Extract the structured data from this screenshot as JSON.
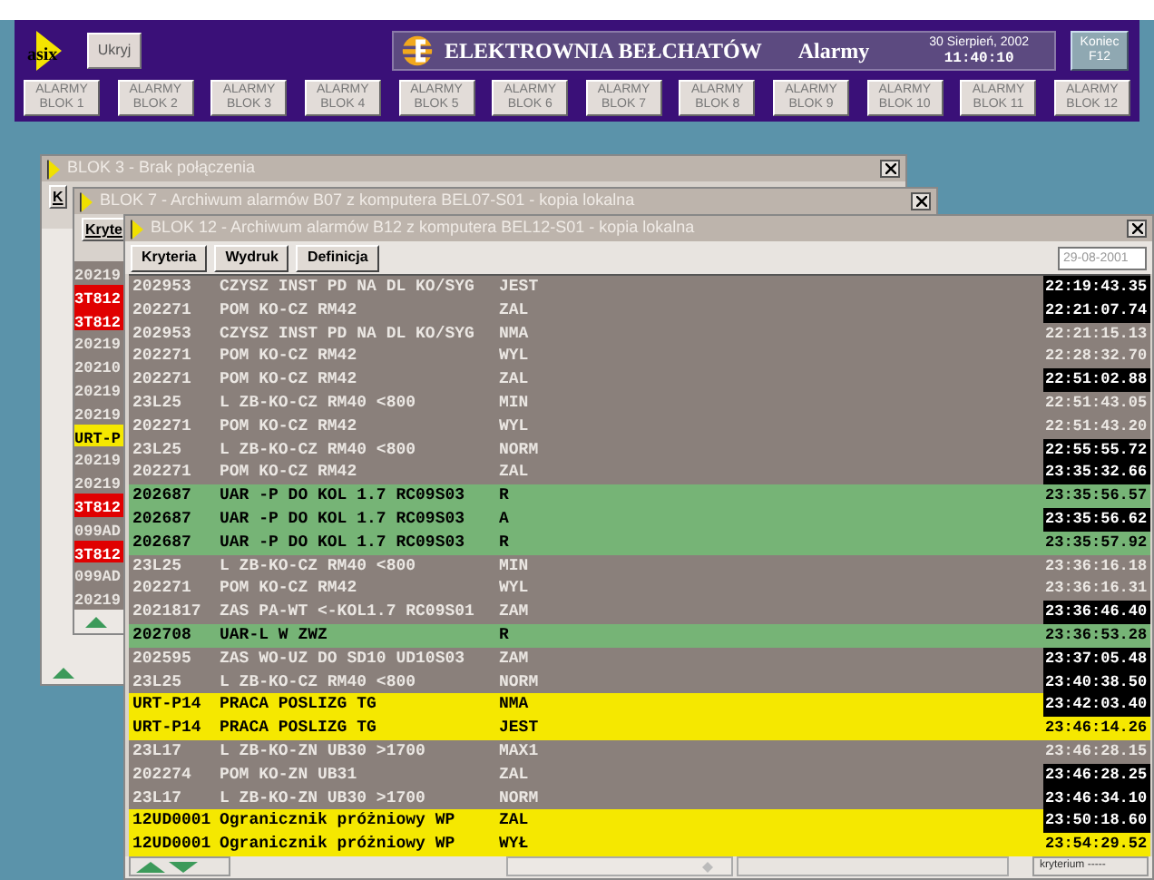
{
  "header": {
    "logo": "asix",
    "hide_button": "Ukryj",
    "plant_name": "ELEKTROWNIA BEŁCHATÓW",
    "screen_name": "Alarmy",
    "date": "30 Sierpień, 2002",
    "time": "11:40:10",
    "exit_button": [
      "Koniec",
      "F12"
    ],
    "block_buttons": [
      {
        "lines": [
          "ALARMY",
          "BLOK 1"
        ]
      },
      {
        "lines": [
          "ALARMY",
          "BLOK 2"
        ]
      },
      {
        "lines": [
          "ALARMY",
          "BLOK 3"
        ]
      },
      {
        "lines": [
          "ALARMY",
          "BLOK 4"
        ]
      },
      {
        "lines": [
          "ALARMY",
          "BLOK 5"
        ]
      },
      {
        "lines": [
          "ALARMY",
          "BLOK 6"
        ]
      },
      {
        "lines": [
          "ALARMY",
          "BLOK 7"
        ]
      },
      {
        "lines": [
          "ALARMY",
          "BLOK 8"
        ]
      },
      {
        "lines": [
          "ALARMY",
          "BLOK 9"
        ]
      },
      {
        "lines": [
          "ALARMY",
          "BLOK 10"
        ]
      },
      {
        "lines": [
          "ALARMY",
          "BLOK 11"
        ]
      },
      {
        "lines": [
          "ALARMY",
          "BLOK 12"
        ]
      }
    ]
  },
  "back_windows": [
    {
      "title": "BLOK 3 - Brak połączenia",
      "toolbar_buttons": [
        "K"
      ]
    },
    {
      "title": "BLOK 7 - Archiwum alarmów B07 z komputera BEL07-S01 - kopia lokalna",
      "toolbar_buttons": [
        "Kryte"
      ],
      "rows": [
        {
          "code": "20219",
          "kind": "normal"
        },
        {
          "code": "3T812",
          "kind": "red"
        },
        {
          "code": "3T812",
          "kind": "red"
        },
        {
          "code": "20219",
          "kind": "normal"
        },
        {
          "code": "20210",
          "kind": "normal"
        },
        {
          "code": "20219",
          "kind": "normal"
        },
        {
          "code": "20219",
          "kind": "normal"
        },
        {
          "code": "URT-P",
          "kind": "yellow"
        },
        {
          "code": "20219",
          "kind": "normal"
        },
        {
          "code": "20219",
          "kind": "normal"
        },
        {
          "code": "3T812",
          "kind": "red"
        },
        {
          "code": "099AD",
          "kind": "normal"
        },
        {
          "code": "3T812",
          "kind": "red"
        },
        {
          "code": "099AD",
          "kind": "normal"
        },
        {
          "code": "20219",
          "kind": "normal"
        }
      ]
    }
  ],
  "window": {
    "title": "BLOK 12 - Archiwum alarmów B12 z komputera BEL12-S01 - kopia lokalna",
    "toolbar_buttons": [
      "Kryteria",
      "Wydruk",
      "Definicja"
    ],
    "date_field": "29-08-2001",
    "status": "kryterium -----",
    "rows": [
      {
        "code": "202953",
        "text": "CZYSZ INST PD NA DL KO/SYG",
        "state": "JEST",
        "time": "22:19:43.35",
        "kind": "normal",
        "highlighted": true
      },
      {
        "code": "202271",
        "text": "POM KO-CZ RM42",
        "state": "ZAL",
        "time": "22:21:07.74",
        "kind": "normal",
        "highlighted": true
      },
      {
        "code": "202953",
        "text": "CZYSZ INST PD NA DL KO/SYG",
        "state": "NMA",
        "time": "22:21:15.13",
        "kind": "normal",
        "highlighted": false
      },
      {
        "code": "202271",
        "text": "POM KO-CZ RM42",
        "state": "WYL",
        "time": "22:28:32.70",
        "kind": "normal",
        "highlighted": false
      },
      {
        "code": "202271",
        "text": "POM KO-CZ RM42",
        "state": "ZAL",
        "time": "22:51:02.88",
        "kind": "normal",
        "highlighted": true
      },
      {
        "code": "23L25",
        "text": "L ZB-KO-CZ RM40 <800",
        "state": "MIN",
        "time": "22:51:43.05",
        "kind": "normal",
        "highlighted": false
      },
      {
        "code": "202271",
        "text": "POM KO-CZ RM42",
        "state": "WYL",
        "time": "22:51:43.20",
        "kind": "normal",
        "highlighted": false
      },
      {
        "code": "23L25",
        "text": "L ZB-KO-CZ RM40 <800",
        "state": "NORM",
        "time": "22:55:55.72",
        "kind": "normal",
        "highlighted": true
      },
      {
        "code": "202271",
        "text": "POM KO-CZ RM42",
        "state": "ZAL",
        "time": "23:35:32.66",
        "kind": "normal",
        "highlighted": true
      },
      {
        "code": "202687",
        "text": "UAR -P DO KOL 1.7 RC09S03",
        "state": "R",
        "time": "23:35:56.57",
        "kind": "green",
        "highlighted": false
      },
      {
        "code": "202687",
        "text": "UAR -P DO KOL 1.7 RC09S03",
        "state": "A",
        "time": "23:35:56.62",
        "kind": "green",
        "highlighted": true
      },
      {
        "code": "202687",
        "text": "UAR -P DO KOL 1.7 RC09S03",
        "state": "R",
        "time": "23:35:57.92",
        "kind": "green",
        "highlighted": false
      },
      {
        "code": "23L25",
        "text": "L ZB-KO-CZ RM40 <800",
        "state": "MIN",
        "time": "23:36:16.18",
        "kind": "normal",
        "highlighted": false
      },
      {
        "code": "202271",
        "text": "POM KO-CZ RM42",
        "state": "WYL",
        "time": "23:36:16.31",
        "kind": "normal",
        "highlighted": false
      },
      {
        "code": "2021817",
        "text": "ZAS PA-WT <-KOL1.7 RC09S01",
        "state": "ZAM",
        "time": "23:36:46.40",
        "kind": "normal",
        "highlighted": true
      },
      {
        "code": "202708",
        "text": "UAR-L W ZWZ",
        "state": "R",
        "time": "23:36:53.28",
        "kind": "green",
        "highlighted": false
      },
      {
        "code": "202595",
        "text": "ZAS WO-UZ DO SD10 UD10S03",
        "state": "ZAM",
        "time": "23:37:05.48",
        "kind": "normal",
        "highlighted": true
      },
      {
        "code": "23L25",
        "text": "L ZB-KO-CZ RM40 <800",
        "state": "NORM",
        "time": "23:40:38.50",
        "kind": "normal",
        "highlighted": true
      },
      {
        "code": "URT-P14",
        "text": "PRACA POSLIZG TG",
        "state": "NMA",
        "time": "23:42:03.40",
        "kind": "yellow",
        "highlighted": true
      },
      {
        "code": "URT-P14",
        "text": "PRACA POSLIZG TG",
        "state": "JEST",
        "time": "23:46:14.26",
        "kind": "yellow",
        "highlighted": false
      },
      {
        "code": "23L17",
        "text": "L ZB-KO-ZN UB30 >1700",
        "state": "MAX1",
        "time": "23:46:28.15",
        "kind": "normal",
        "highlighted": false
      },
      {
        "code": "202274",
        "text": "POM KO-ZN UB31",
        "state": "ZAL",
        "time": "23:46:28.25",
        "kind": "normal",
        "highlighted": true
      },
      {
        "code": "23L17",
        "text": "L ZB-KO-ZN UB30 >1700",
        "state": "NORM",
        "time": "23:46:34.10",
        "kind": "normal",
        "highlighted": true
      },
      {
        "code": "12UD0001",
        "text": "Ogranicznik próżniowy WP",
        "state": "ZAL",
        "time": "23:50:18.60",
        "kind": "yellow",
        "highlighted": true
      },
      {
        "code": "12UD0001",
        "text": "Ogranicznik próżniowy WP",
        "state": "WYŁ",
        "time": "23:54:29.52",
        "kind": "yellow",
        "highlighted": false
      }
    ]
  }
}
